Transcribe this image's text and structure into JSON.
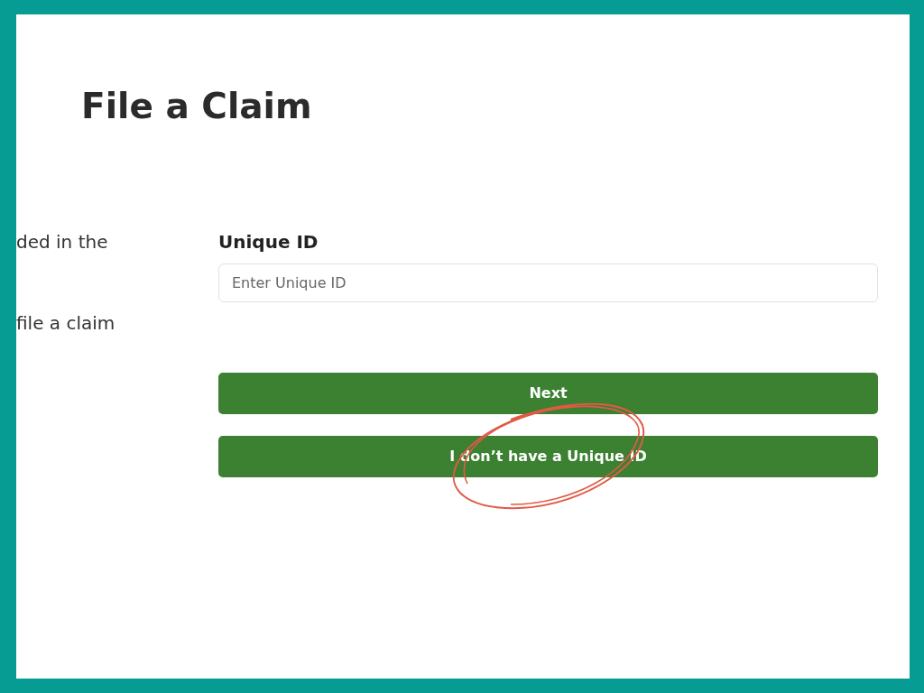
{
  "title": "File a Claim",
  "intro_lines": [
    "ded in the",
    "file a claim"
  ],
  "field": {
    "label": "Unique ID",
    "placeholder": "Enter Unique ID"
  },
  "buttons": [
    {
      "label": "Next",
      "annotated": false
    },
    {
      "label": "I don’t have a Unique ID",
      "annotated": true
    }
  ]
}
